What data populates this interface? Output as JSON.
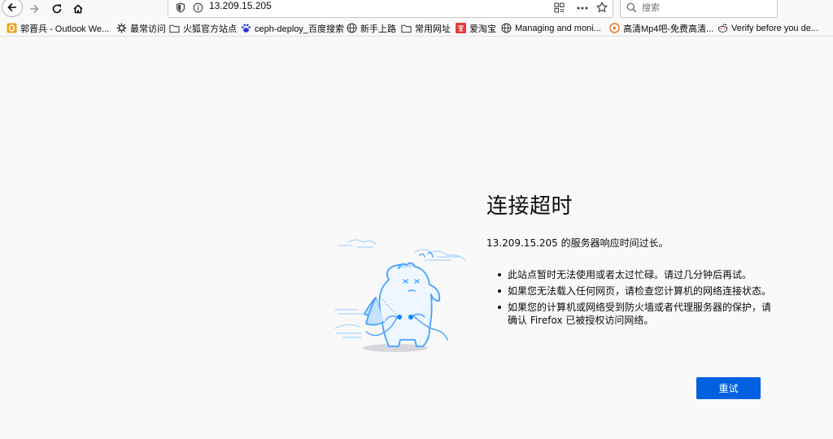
{
  "toolbar": {
    "url": "13.209.15.205",
    "search_placeholder": "搜索"
  },
  "bookmarks": [
    {
      "label": "郭晋兵 - Outlook We...",
      "icon": "outlook-icon"
    },
    {
      "label": "最常访问",
      "icon": "gear-icon"
    },
    {
      "label": "火狐官方站点",
      "icon": "folder-icon"
    },
    {
      "label": "ceph-deploy_百度搜索",
      "icon": "baidu-paw-icon"
    },
    {
      "label": "新手上路",
      "icon": "globe-icon"
    },
    {
      "label": "常用网址",
      "icon": "folder-icon"
    },
    {
      "label": "爱淘宝",
      "icon": "taobao-icon"
    },
    {
      "label": "Managing and moni...",
      "icon": "globe-icon"
    },
    {
      "label": "高清Mp4吧-免费高清...",
      "icon": "play-icon"
    },
    {
      "label": "Verify before you de...",
      "icon": "reddit-icon"
    }
  ],
  "error": {
    "title": "连接超时",
    "description": "13.209.15.205 的服务器响应时间过长。",
    "items": [
      "此站点暂时无法使用或者太过忙碌。请过几分钟后再试。",
      "如果您无法载入任何网页，请检查您计算机的网络连接状态。",
      "如果您的计算机或网络受到防火墙或者代理服务器的保护，请确认 Firefox 已被授权访问网络。"
    ],
    "retry_label": "重试"
  },
  "colors": {
    "accent": "#0060df",
    "page_bg": "#f9f9fa",
    "illustration": "#45a1ff"
  }
}
